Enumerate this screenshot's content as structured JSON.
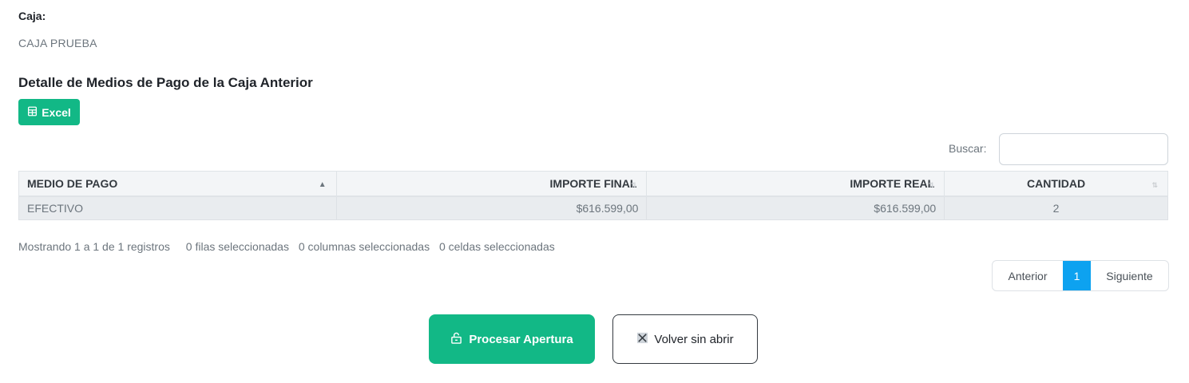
{
  "caja": {
    "label": "Caja:",
    "value": "CAJA PRUEBA"
  },
  "section": {
    "title": "Detalle de Medios de Pago de la Caja Anterior"
  },
  "toolbar": {
    "excel_label": "Excel",
    "excel_icon": "file-excel-icon"
  },
  "search": {
    "label": "Buscar:",
    "value": ""
  },
  "table": {
    "columns": [
      "MEDIO DE PAGO",
      "IMPORTE FINAL",
      "IMPORTE REAL",
      "CANTIDAD"
    ],
    "rows": [
      [
        "EFECTIVO",
        "$616.599,00",
        "$616.599,00",
        "2"
      ]
    ],
    "sort_icons": {
      "active": "▲",
      "inactive": "⇅"
    }
  },
  "info": {
    "registros": "Mostrando 1 a 1 de 1 registros",
    "filas": "0 filas seleccionadas",
    "columnas": "0 columnas seleccionadas",
    "celdas": "0 celdas seleccionadas"
  },
  "pagination": {
    "prev": "Anterior",
    "current": "1",
    "next": "Siguiente"
  },
  "actions": {
    "procesar_label": "Procesar Apertura",
    "procesar_icon": "unlock-icon",
    "volver_label": "Volver sin abrir",
    "volver_icon": "close-icon"
  },
  "colors": {
    "accent": "#12b886",
    "page_active": "#0da2f0"
  }
}
